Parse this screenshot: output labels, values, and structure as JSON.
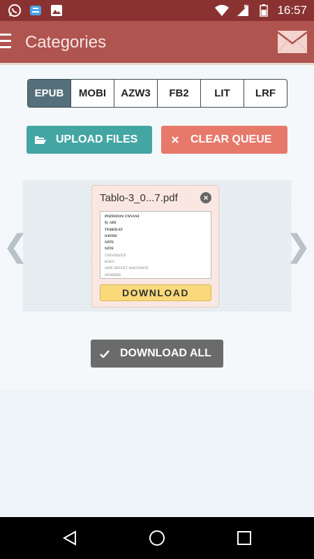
{
  "status_bar": {
    "time": "16:57",
    "left_icons": [
      "whatsapp-icon",
      "app-store-icon",
      "image-icon"
    ],
    "right_icons": [
      "wifi-icon",
      "signal-icon",
      "battery-icon"
    ]
  },
  "app_bar": {
    "title": "Categories",
    "menu_icon": "hamburger-menu-icon",
    "mail_icon": "envelope-icon"
  },
  "format_tabs": [
    {
      "label": "EPUB",
      "active": true
    },
    {
      "label": "MOBI",
      "active": false
    },
    {
      "label": "AZW3",
      "active": false
    },
    {
      "label": "FB2",
      "active": false
    },
    {
      "label": "LIT",
      "active": false
    },
    {
      "label": "LRF",
      "active": false
    }
  ],
  "actions": {
    "upload_label": "UPLOAD FILES",
    "clear_label": "CLEAR QUEUE",
    "download_all_label": "DOWNLOAD ALL"
  },
  "queue": {
    "files": [
      {
        "name": "Tablo-3_0...7.pdf",
        "download_label": "DOWNLOAD",
        "thumbnail_lines": [
          "POZİSYON UNVANI",
          "İL ADI",
          "TEŞKİLAT",
          "SAYISI",
          "NİTE",
          "NİTE",
          "ÜNİVERSİTE",
          "KODU",
          "ADIE DEVLET HASTANESİ",
          "HEMŞİRE"
        ]
      }
    ]
  },
  "colors": {
    "status_bar": "#8a3232",
    "app_bar": "#b05450",
    "tab_active": "#55707b",
    "upload": "#44a6a3",
    "clear": "#e7796b",
    "download": "#f9d97a",
    "download_all": "#6b6b6b"
  }
}
